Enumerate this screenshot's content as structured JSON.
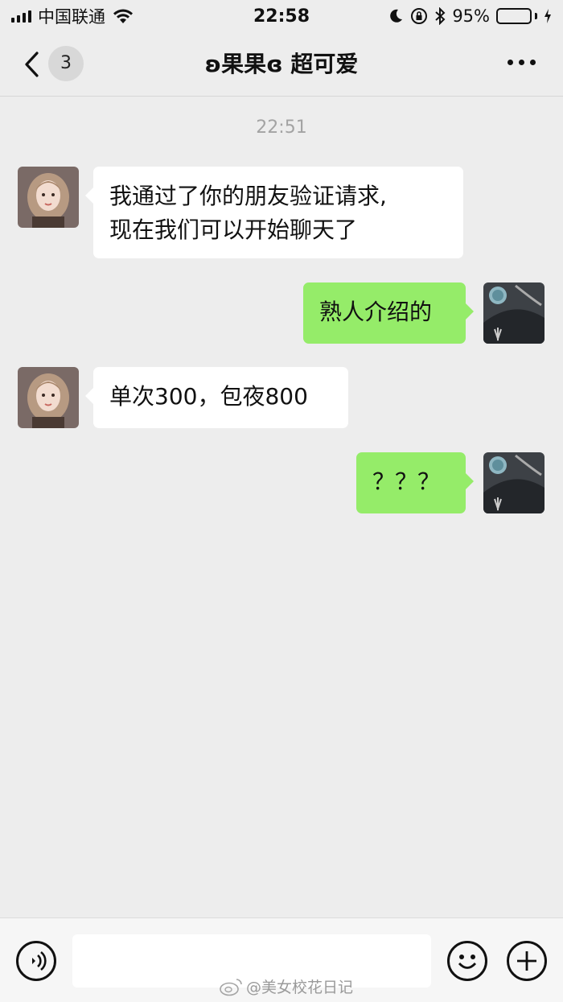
{
  "status_bar": {
    "carrier": "中国联通",
    "time": "22:58",
    "battery_percent": "95%",
    "battery_level": 0.95,
    "battery_color": "#4cd964"
  },
  "nav": {
    "back_icon": "chevron-left-icon",
    "unread_count": "3",
    "title": "ʚ果果ɞ 超可爱",
    "more_icon": "more-dots-icon"
  },
  "chat": {
    "timestamp": "22:51",
    "messages": [
      {
        "side": "left",
        "lines": [
          "我通过了你的朋友验证请求,",
          "现在我们可以开始聊天了"
        ]
      },
      {
        "side": "right",
        "text": "熟人介绍的"
      },
      {
        "side": "left",
        "text": "单次300，包夜800"
      },
      {
        "side": "right",
        "text": "？？？"
      }
    ],
    "colors": {
      "incoming": "#ffffff",
      "outgoing": "#95ec69"
    }
  },
  "input_bar": {
    "voice_icon": "voice-icon",
    "emoji_icon": "emoji-icon",
    "plus_icon": "plus-icon"
  },
  "watermark": "@美女校花日记"
}
